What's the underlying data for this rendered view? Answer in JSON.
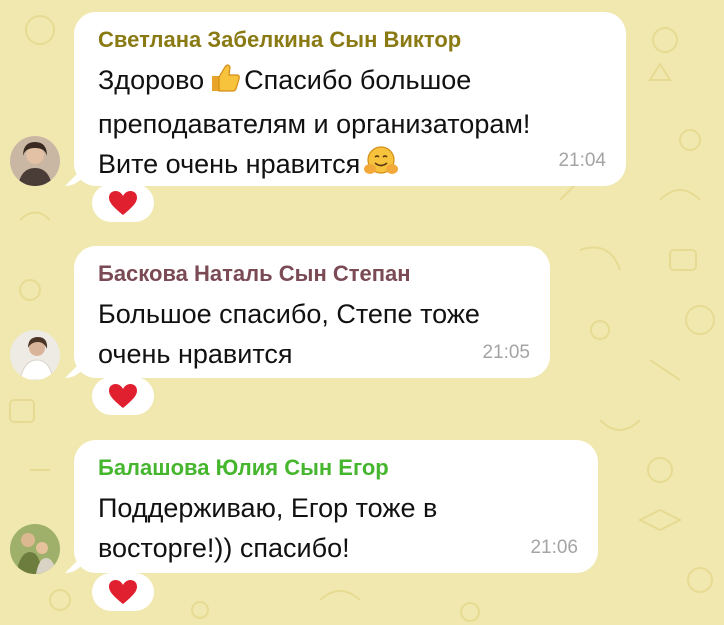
{
  "messages": [
    {
      "sender": "Светлана Забелкина Сын Виктор",
      "sender_color": "#8a7a14",
      "text_line1_a": "Здорово",
      "text_line1_emoji": "thumbs-up-emoji",
      "text_line1_b": "Спасибо большое",
      "text_line2": "преподавателям и организаторам!",
      "text_line3": "Вите очень нравится",
      "text_line3_emoji": "hugging-face-emoji",
      "time": "21:04",
      "reaction": "red-heart-icon"
    },
    {
      "sender": "Баскова Наталь Сын Степан",
      "sender_color": "#7a4a55",
      "text_line1": "Большое спасибо, Степе тоже",
      "text_line2": "очень нравится",
      "time": "21:05",
      "reaction": "red-heart-icon"
    },
    {
      "sender": "Балашова Юлия Сын Егор",
      "sender_color": "#47b62f",
      "text_line1": "Поддерживаю, Егор тоже в",
      "text_line2": "восторге!)) спасибо!",
      "time": "21:06",
      "reaction": "red-heart-icon"
    }
  ],
  "colors": {
    "background": "#f1e8b0",
    "bubble": "#ffffff",
    "time": "#a4a4a4",
    "heart": "#e0202f"
  }
}
